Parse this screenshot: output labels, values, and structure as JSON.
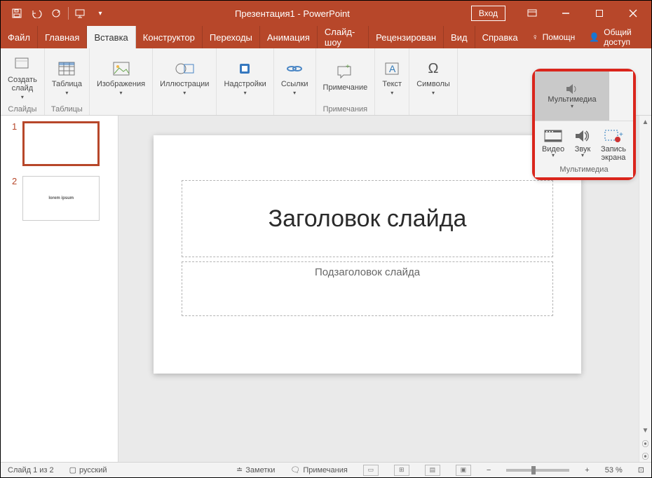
{
  "title": "Презентация1 - PowerPoint",
  "signin": "Вход",
  "tabs": {
    "file": "Файл",
    "home": "Главная",
    "insert": "Вставка",
    "design": "Конструктор",
    "transitions": "Переходы",
    "animations": "Анимация",
    "slideshow": "Слайд-шоу",
    "review": "Рецензирован",
    "view": "Вид",
    "help": "Справка"
  },
  "tellme": "Помощн",
  "share": "Общий доступ",
  "ribbon": {
    "new_slide": "Создать\nслайд",
    "slides_group": "Слайды",
    "table": "Таблица",
    "tables_group": "Таблицы",
    "images": "Изображения",
    "illustrations": "Иллюстрации",
    "addins": "Надстройки",
    "links": "Ссылки",
    "comment": "Примечание",
    "comments_group": "Примечания",
    "text": "Текст",
    "symbols": "Символы",
    "media": "Мультимедиа"
  },
  "flyout": {
    "media": "Мультимедиа",
    "video": "Видео",
    "audio": "Звук",
    "screenrec": "Запись\nэкрана",
    "group": "Мультимедиа"
  },
  "slide": {
    "title": "Заголовок слайда",
    "subtitle": "Подзаголовок слайда"
  },
  "thumbs": {
    "n1": "1",
    "n2": "2",
    "mini2": "lorem ipsum"
  },
  "status": {
    "slide": "Слайд 1 из 2",
    "lang": "русский",
    "notes": "Заметки",
    "comments": "Примечания",
    "zoom": "53 %"
  }
}
